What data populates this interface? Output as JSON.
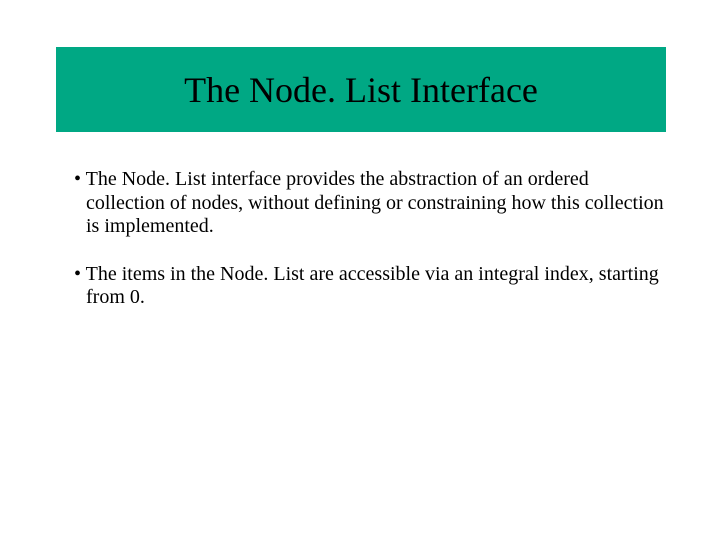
{
  "title": "The Node. List Interface",
  "bullets": [
    "The Node. List interface provides the abstraction of an ordered collection of nodes, without defining or constraining how this collection is implemented.",
    "The items in the Node. List are accessible via an integral index, starting from 0."
  ]
}
